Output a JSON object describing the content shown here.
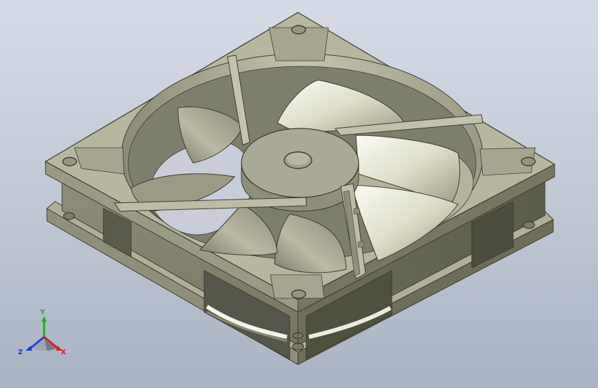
{
  "viewport": {
    "background_top": "#d6dce6",
    "background_bottom": "#a9b3c2"
  },
  "model": {
    "part": "axial fan",
    "view": "isometric",
    "body_color": "#b3b39a",
    "shadow_color": "#6a6a58",
    "hub_color": "#a8a894"
  },
  "triad": {
    "x_label": "X",
    "y_label": "Y",
    "z_label": "Z",
    "x_color": "#e02020",
    "y_color": "#20b020",
    "z_color": "#2040e0"
  }
}
